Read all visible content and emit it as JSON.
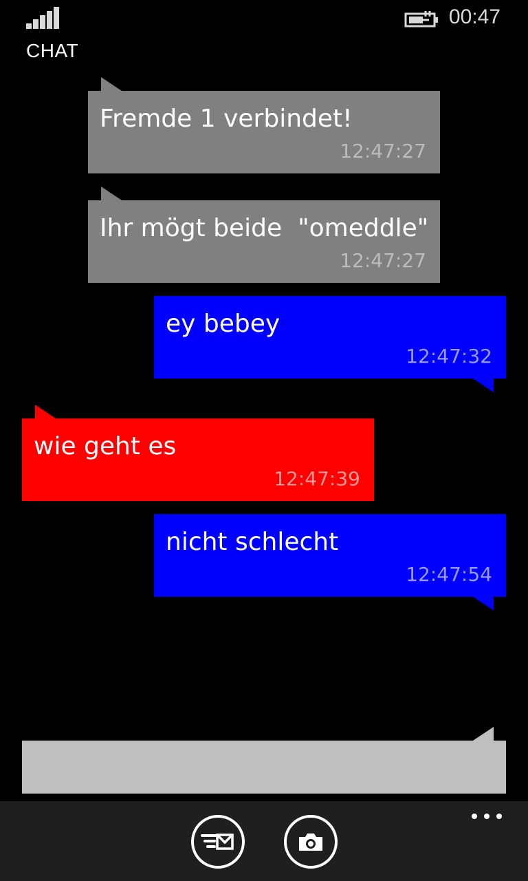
{
  "status": {
    "time": "00:47",
    "signal_icon": "signal-strength-icon",
    "battery_icon": "battery-charging-icon"
  },
  "header": {
    "title": "CHAT"
  },
  "messages": [
    {
      "sender": "system",
      "text": "Fremde 1 verbindet!",
      "time": "12:47:27",
      "color": "#808080"
    },
    {
      "sender": "system",
      "text": "Ihr mögt beide  \"omeddle\"",
      "time": "12:47:27",
      "color": "#808080"
    },
    {
      "sender": "me",
      "text": "ey bebey",
      "time": "12:47:32",
      "color": "#0000ff"
    },
    {
      "sender": "stranger",
      "text": "wie geht es",
      "time": "12:47:39",
      "color": "#ff0000"
    },
    {
      "sender": "me",
      "text": "nicht schlecht",
      "time": "12:47:54",
      "color": "#0000ff"
    }
  ],
  "composer": {
    "value": "",
    "placeholder": ""
  },
  "appbar": {
    "buttons": [
      "send-message-icon",
      "camera-icon"
    ],
    "more_icon": "more-dots-icon"
  }
}
